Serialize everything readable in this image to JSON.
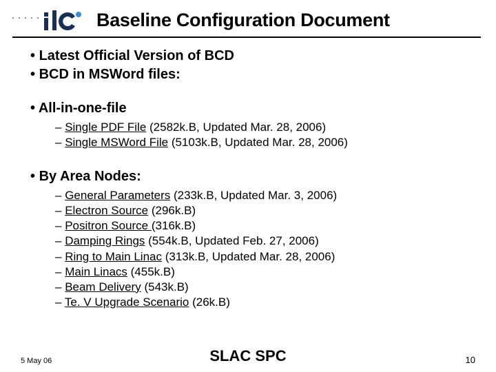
{
  "header": {
    "title": "Baseline Configuration Document",
    "logo_text": "ilc"
  },
  "bullets": {
    "b1": "Latest Official Version of BCD",
    "b2": "BCD in MSWord files:",
    "b3": "All-in-one-file",
    "b4": "By Area Nodes:"
  },
  "allinone": {
    "i1": {
      "name": "Single PDF File",
      "meta": " (2582k.B, Updated Mar. 28, 2006)"
    },
    "i2": {
      "name": "Single MSWord File",
      "meta": " (5103k.B, Updated Mar. 28, 2006)"
    }
  },
  "areanodes": {
    "n1": {
      "name": "General Parameters",
      "meta": " (233k.B, Updated Mar. 3, 2006)"
    },
    "n2": {
      "name": "Electron Source",
      "meta": " (296k.B)"
    },
    "n3": {
      "name": "Positron Source ",
      "meta": "(316k.B)"
    },
    "n4": {
      "name": "Damping Rings",
      "meta": " (554k.B, Updated Feb. 27, 2006)"
    },
    "n5": {
      "name": "Ring to Main Linac",
      "meta": " (313k.B, Updated Mar. 28, 2006)"
    },
    "n6": {
      "name": "Main Linacs",
      "meta": " (455k.B)"
    },
    "n7": {
      "name": "Beam Delivery",
      "meta": " (543k.B)"
    },
    "n8": {
      "name": "Te. V Upgrade Scenario",
      "meta": " (26k.B)"
    }
  },
  "footer": {
    "date": "5 May 06",
    "center": "SLAC SPC",
    "page": "10"
  }
}
